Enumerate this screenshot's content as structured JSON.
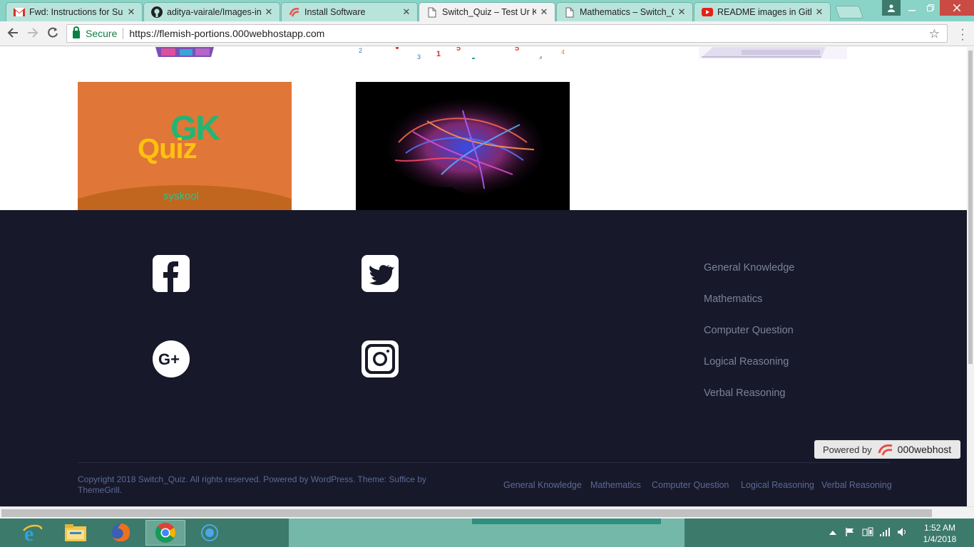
{
  "browser": {
    "tabs": [
      {
        "title": "Fwd: Instructions for Sub",
        "icon": "gmail-icon"
      },
      {
        "title": "aditya-vairale/Images-in-",
        "icon": "github-icon"
      },
      {
        "title": "Install Software",
        "icon": "000webhost-icon"
      },
      {
        "title": "Switch_Quiz – Test Ur Kn",
        "icon": "page-icon",
        "active": true
      },
      {
        "title": "Mathematics – Switch_Q",
        "icon": "page-icon"
      },
      {
        "title": "README images in Githu",
        "icon": "youtube-icon"
      }
    ],
    "secure_label": "Secure",
    "url": "https://flemish-portions.000webhostapp.com"
  },
  "footer": {
    "social": [
      "facebook-icon",
      "twitter-icon",
      "google-plus-icon",
      "instagram-icon"
    ],
    "widget_links": [
      "General Knowledge",
      "Mathematics",
      "Computer Question",
      "Logical Reasoning",
      "Verbal Reasoning"
    ],
    "copyright": "Copyright 2018 Switch_Quiz. All rights reserved. Powered by WordPress. Theme: Suffice by ThemeGrill.",
    "nav_links": [
      "General Knowledge",
      "Mathematics",
      "Computer Question",
      "Logical Reasoning",
      "Verbal Reasoning"
    ]
  },
  "gk_image": {
    "gk": "GK",
    "quiz": "Quiz",
    "brand": "syskool"
  },
  "badge": {
    "powered_by": "Powered by",
    "host": "000webhost"
  },
  "taskbar": {
    "time": "1:52 AM",
    "date": "1/4/2018"
  },
  "colors": {
    "footer_bg": "#17192a",
    "link": "#7b8297",
    "tab_strip": "#8ad3c7",
    "taskbar": "#3c7a6c"
  }
}
